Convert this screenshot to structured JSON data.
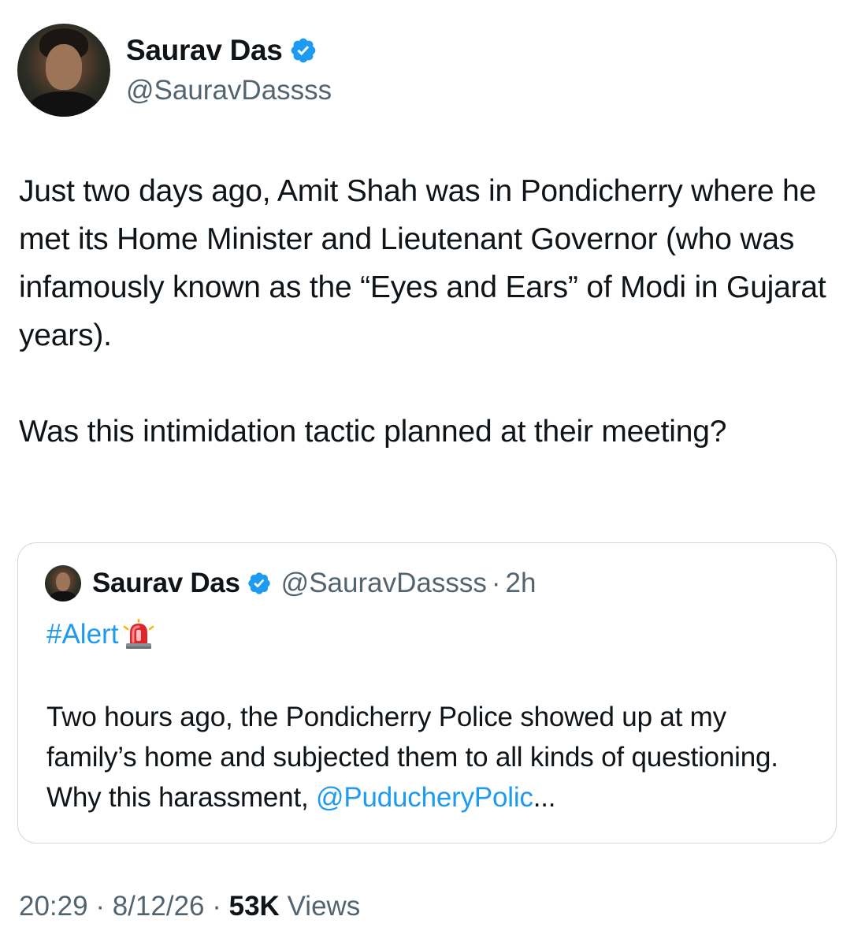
{
  "author": {
    "name": "Saurav Das",
    "handle": "@SauravDassss"
  },
  "tweet": {
    "paragraph1": "Just two days ago, Amit Shah was in Pondicherry where he met its Home Minister and Lieutenant Governor (who was infamously known as the “Eyes and Ears” of Modi in Gujarat years).",
    "paragraph2": "Was this intimidation tactic planned at their meeting?"
  },
  "quoted": {
    "name": "Saurav Das",
    "handle": "@SauravDassss",
    "separator": "·",
    "time": "2h",
    "hashtag": "#Alert",
    "text": "Two hours ago, the Pondicherry Police showed up at my family’s home and subjected them to all kinds of questioning. Why this harassment, ",
    "mention": "@PuducheryPolic",
    "ellipsis": "..."
  },
  "meta": {
    "time": "20:29",
    "sep1": "·",
    "date": "8/12/26",
    "sep2": "·",
    "views_count": "53K",
    "views_label": "Views"
  },
  "icons": {
    "verified": "verified-badge-icon",
    "siren": "police-siren-icon"
  },
  "colors": {
    "link": "#1d9bf0",
    "secondary_text": "#536471",
    "primary_text": "#0f1419",
    "border": "#cfd9de"
  }
}
